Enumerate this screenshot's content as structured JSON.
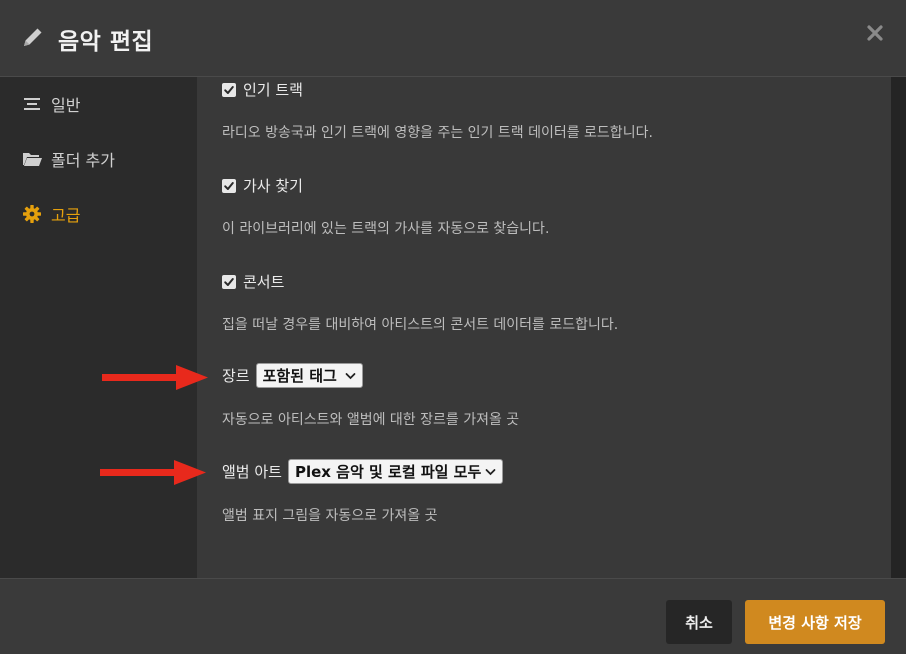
{
  "dialog": {
    "title": "음악 편집",
    "pencil_icon": "pencil-icon",
    "close_icon": "close-icon"
  },
  "sidebar": {
    "items": [
      {
        "label": "일반",
        "icon": "list-icon",
        "active": false
      },
      {
        "label": "폴더 추가",
        "icon": "folder-icon",
        "active": false
      },
      {
        "label": "고급",
        "icon": "gear-icon",
        "active": true
      }
    ]
  },
  "options": [
    {
      "label": "인기 트랙",
      "checked": true,
      "description": "라디오 방송국과 인기 트랙에 영향을 주는 인기 트랙 데이터를 로드합니다."
    },
    {
      "label": "가사 찾기",
      "checked": true,
      "description": "이 라이브러리에 있는 트랙의 가사를 자동으로 찾습니다."
    },
    {
      "label": "콘서트",
      "checked": true,
      "description": "집을 떠날 경우를 대비하여 아티스트의 콘서트 데이터를 로드합니다."
    }
  ],
  "selects": [
    {
      "label": "장르",
      "value": "포함된 태그",
      "description": "자동으로 아티스트와 앨범에 대한 장르를 가져올 곳"
    },
    {
      "label": "앨범 아트",
      "value": "Plex 음악 및 로컬 파일 모두",
      "description": "앨범 표지 그림을 자동으로 가져올 곳"
    }
  ],
  "footer": {
    "cancel_label": "취소",
    "save_label": "변경 사항 저장"
  },
  "colors": {
    "accent": "#e5a00d",
    "save_button": "#d0891f",
    "arrow": "#e8291c"
  }
}
